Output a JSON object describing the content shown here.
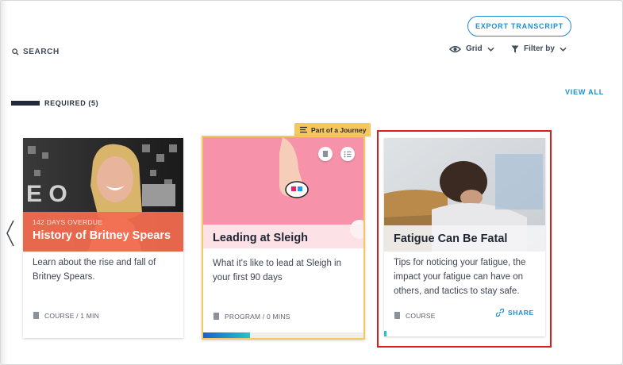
{
  "header": {
    "export_label": "EXPORT TRANSCRIPT",
    "search_label": "SEARCH",
    "view_label": "Grid",
    "filter_label": "Filter by",
    "view_all_label": "VIEW ALL"
  },
  "section": {
    "label": "REQUIRED (5)"
  },
  "cards": [
    {
      "status": "142 DAYS OVERDUE",
      "title": "History of Britney Spears",
      "description": "Learn about the rise and fall of Britney Spears.",
      "meta": "COURSE / 1 MIN"
    },
    {
      "tag": "Part of a Journey",
      "title": "Leading at Sleigh",
      "description": "What it's like to lead at Sleigh in your first 90 days",
      "meta": "PROGRAM / 0 MINS",
      "progress": 0.29
    },
    {
      "title": "Fatigue Can Be Fatal",
      "description": "Tips for noticing your fatigue, the impact your fatigue can have on others, and tactics to stay safe.",
      "meta": "COURSE",
      "share_label": "SHARE"
    }
  ],
  "colors": {
    "accent": "#1b8fcf",
    "overdue": "#f26b4f",
    "journey": "#f6c75c",
    "highlight": "#d91e1e"
  }
}
